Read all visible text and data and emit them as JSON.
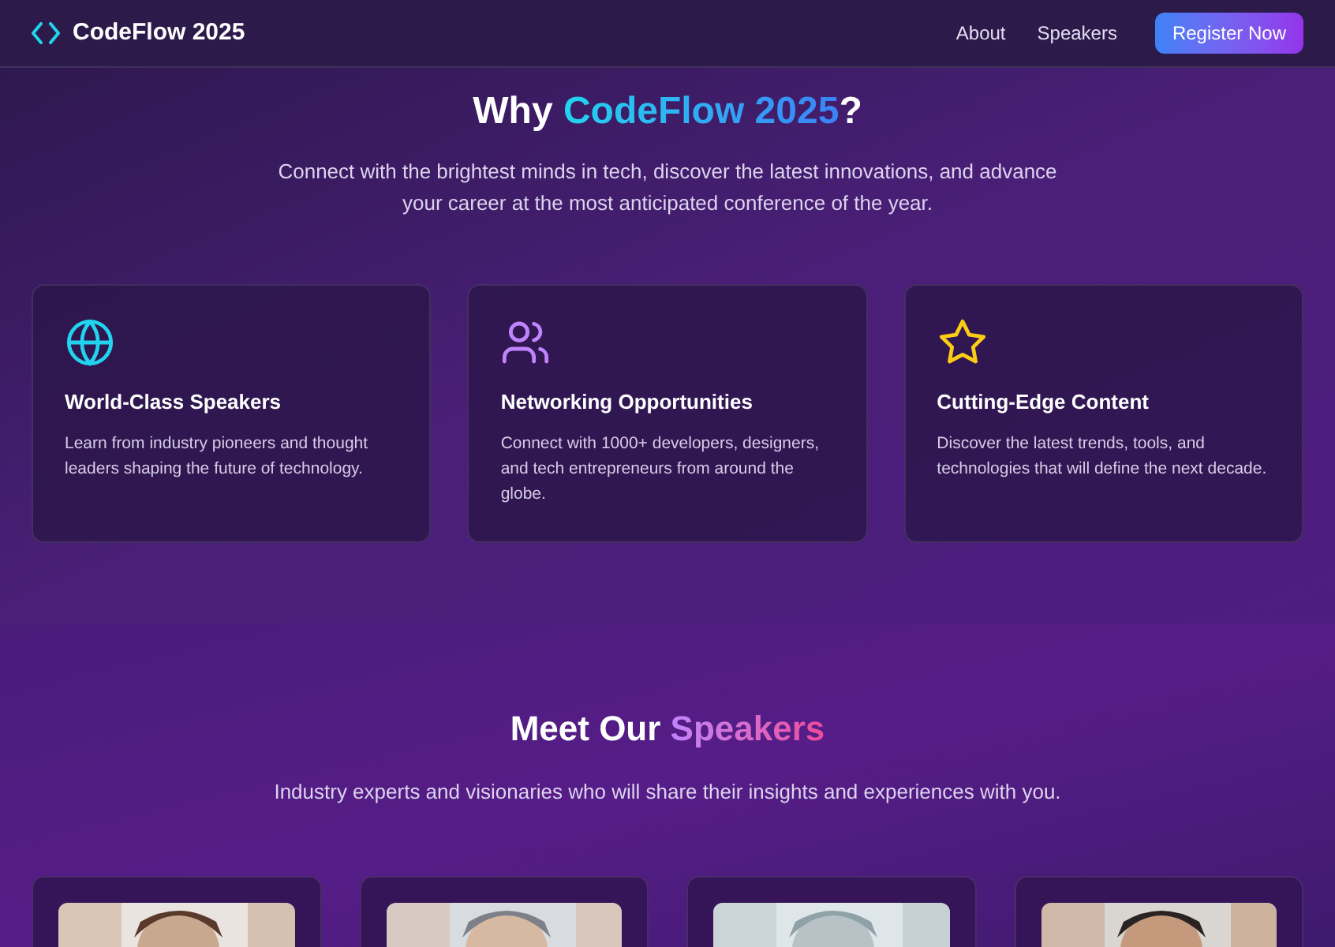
{
  "nav": {
    "logo": "CodeFlow 2025",
    "links": [
      "About",
      "Speakers"
    ],
    "cta": "Register Now"
  },
  "why": {
    "title": {
      "before": "Why ",
      "highlight": "CodeFlow 2025",
      "after": "?"
    },
    "intro": "Connect with the brightest minds in tech, discover the latest innovations, and advance your career at the most anticipated conference of the year.",
    "features": [
      {
        "kind": "globe",
        "title": "World-Class Speakers",
        "text": "Learn from industry pioneers and thought leaders shaping the future of technology."
      },
      {
        "kind": "people",
        "title": "Networking Opportunities",
        "text": "Connect with 1000+ developers, designers, and tech entrepreneurs from around the globe."
      },
      {
        "kind": "star",
        "title": "Cutting-Edge Content",
        "text": "Discover the latest trends, tools, and technologies that will define the next decade."
      }
    ]
  },
  "speakers": {
    "title": {
      "before": "Meet Our ",
      "highlight": "Speakers"
    },
    "intro": "Industry experts and visionaries who will share their insights and experiences with you."
  }
}
